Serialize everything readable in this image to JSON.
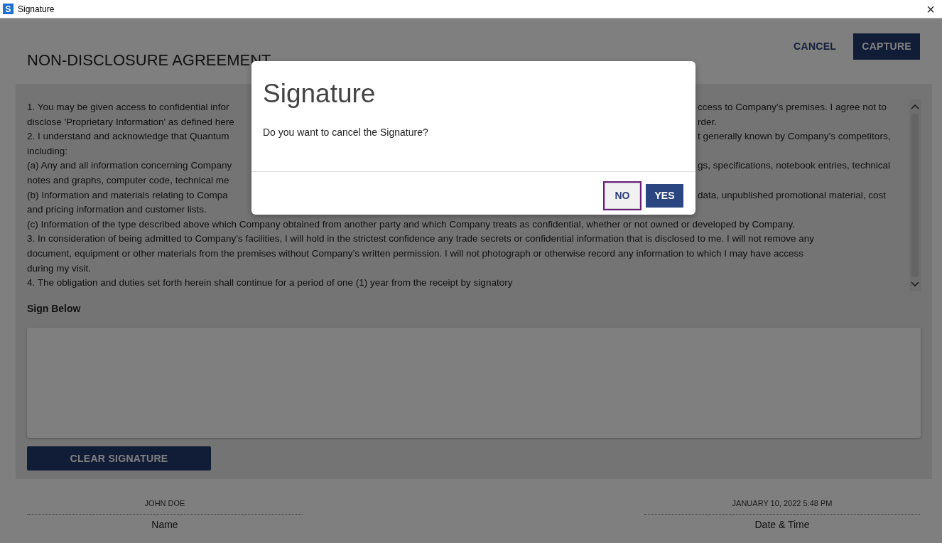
{
  "window": {
    "icon": "S",
    "title": "Signature",
    "close": "×"
  },
  "header": {
    "title": "NON-DISCLOSURE AGREEMENT",
    "buttons": [
      {
        "label": "CANCEL",
        "kind": "text"
      },
      {
        "label": "CAPTURE",
        "kind": "primary"
      }
    ]
  },
  "agreement": {
    "lines": [
      {
        "left": "1. You may be given access to confidential infor",
        "right": "ccess to Company’s premises. I agree not to"
      },
      {
        "left": "disclose 'Proprietary Information' as defined here",
        "right": "rder."
      },
      {
        "left": "2. I understand and acknowledge that Quantum",
        "right": "t generally known by Company’s competitors,"
      },
      {
        "left": "including:"
      },
      {
        "left": "(a) Any and all information concerning Company",
        "right": "gs, specifications, notebook entries, technical"
      },
      {
        "left": "notes and graphs, computer code, technical me"
      },
      {
        "left": "(b) Information and materials relating to Compa",
        "right": "data, unpublished promotional material, cost"
      },
      {
        "left": "and pricing information and customer lists."
      },
      {
        "left": "(c) Information of the type described above which Company obtained from another party and which Company treats as confidential, whether or not owned or developed by Company."
      },
      {
        "left": "3. In consideration of being admitted to Company’s facilities, I will hold in the strictest confidence any trade secrets or confidential information that is disclosed to me. I will not remove any"
      },
      {
        "left": "document, equipment or other materials from the premises without Company’s written permission. I will not photograph or otherwise record any information to which I may have access"
      },
      {
        "left": "during my visit."
      },
      {
        "left": "4. The obligation and duties set forth herein shall continue for a period of one (1) year from the receipt by signatory"
      }
    ]
  },
  "sign_label": "Sign Below",
  "clear_button": "CLEAR SIGNATURE",
  "fields": [
    {
      "value": "JOHN DOE",
      "label": "Name"
    },
    {
      "value": "JANUARY 10, 2022 5:48 PM",
      "label": "Date & Time"
    }
  ],
  "dialog": {
    "title": "Signature",
    "message": "Do you want to cancel the Signature?",
    "buttons": [
      {
        "label": "NO",
        "kind": "secondary",
        "focused": true
      },
      {
        "label": "YES",
        "kind": "primary",
        "focused": false
      }
    ]
  }
}
